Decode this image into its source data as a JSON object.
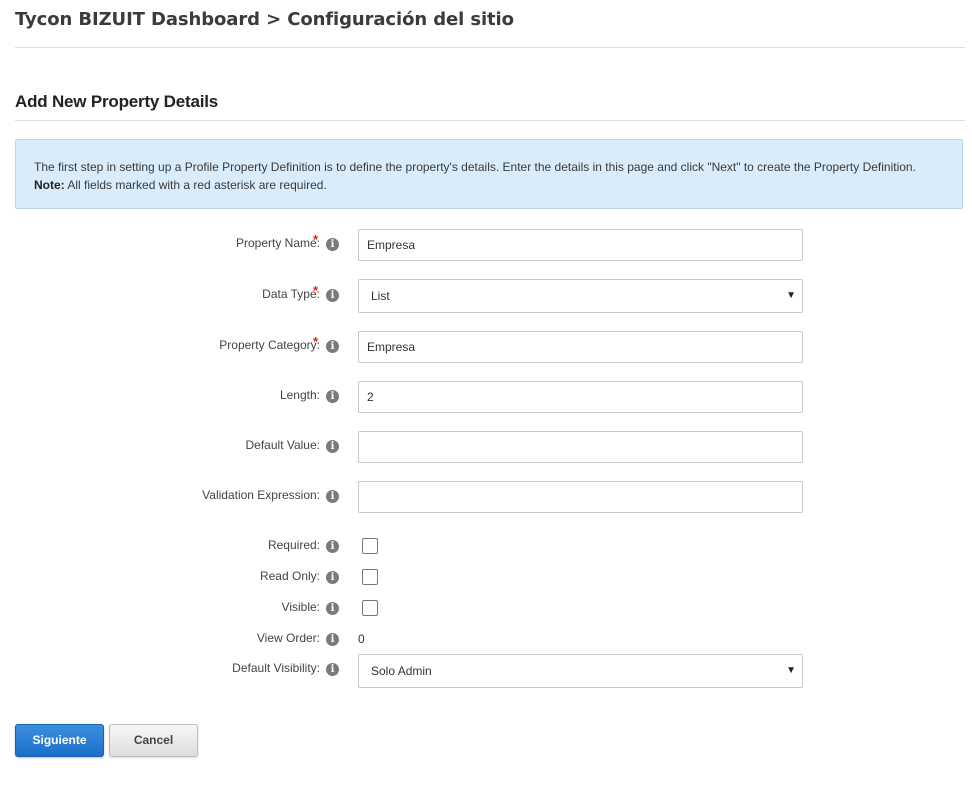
{
  "header": {
    "title": "Tycon BIZUIT Dashboard > Configuración del sitio"
  },
  "section": {
    "title": "Add New Property Details"
  },
  "info": {
    "text": "The first step in setting up a Profile Property Definition is to define the property's details. Enter the details in this page and click \"Next\" to create the Property Definition.",
    "note_label": "Note:",
    "note_text": " All fields marked with a red asterisk are required."
  },
  "form": {
    "required_marker": "*",
    "info_glyph": "i",
    "property_name": {
      "label": "Property Name:",
      "value": "Empresa"
    },
    "data_type": {
      "label": "Data Type:",
      "value": "List",
      "caret": "▼"
    },
    "property_category": {
      "label": "Property Category:",
      "value": "Empresa"
    },
    "length": {
      "label": "Length:",
      "value": "2"
    },
    "default_value": {
      "label": "Default Value:",
      "value": ""
    },
    "validation_expression": {
      "label": "Validation Expression:",
      "value": ""
    },
    "required": {
      "label": "Required:",
      "checked": false
    },
    "read_only": {
      "label": "Read Only:",
      "checked": false
    },
    "visible": {
      "label": "Visible:",
      "checked": false
    },
    "view_order": {
      "label": "View Order:",
      "value": "0"
    },
    "default_visibility": {
      "label": "Default Visibility:",
      "value": "Solo Admin",
      "caret": "▼"
    }
  },
  "actions": {
    "next_label": "Siguiente",
    "cancel_label": "Cancel"
  },
  "colors": {
    "info_background": "#d8ecfb",
    "primary_button": "#1c6fc8",
    "required_asterisk": "#e02020"
  },
  "icons": {
    "field_help": "info-circle-icon",
    "dropdown": "caret-down-icon"
  }
}
